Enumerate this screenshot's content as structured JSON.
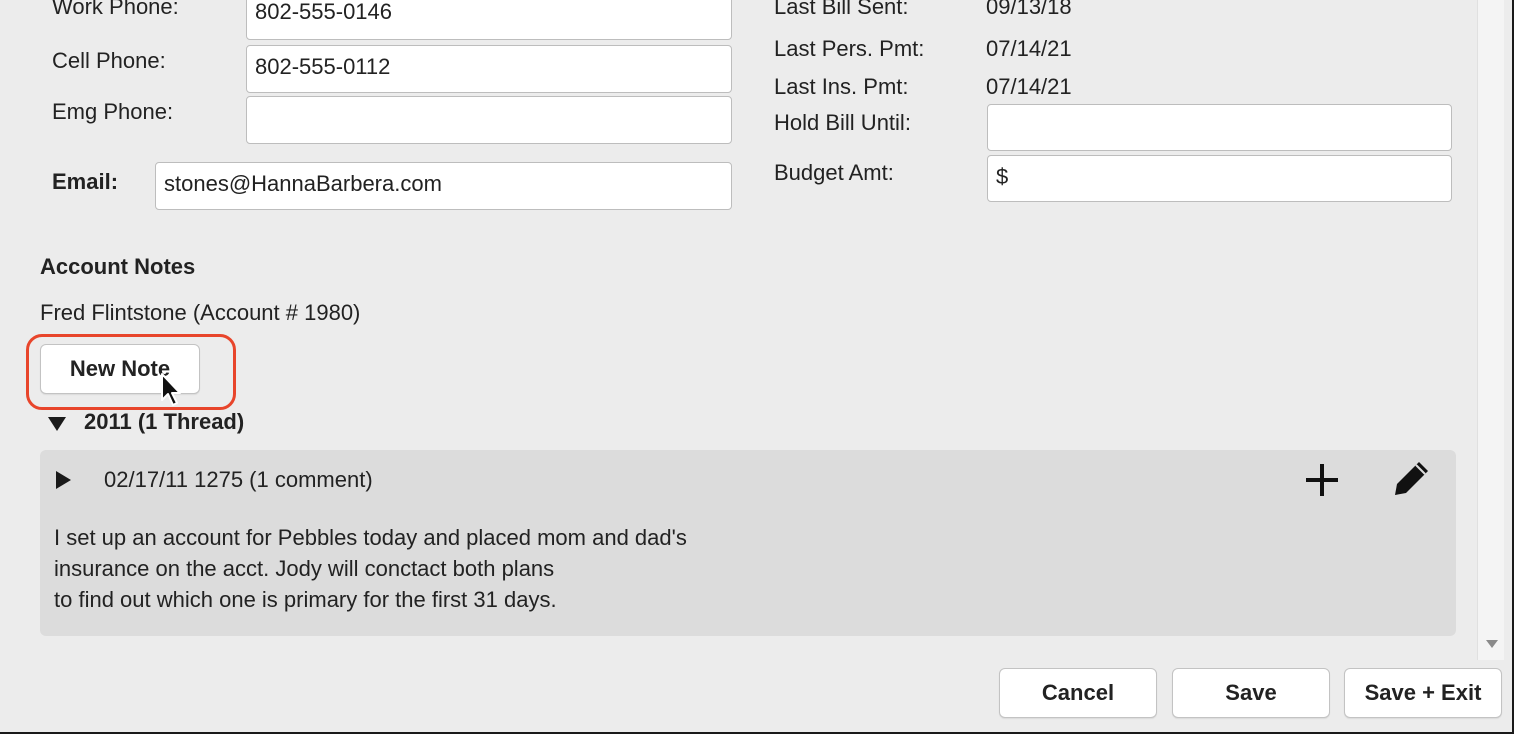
{
  "contact": {
    "work_phone_label": "Work Phone:",
    "work_phone_value": "802-555-0146",
    "cell_phone_label": "Cell Phone:",
    "cell_phone_value": "802-555-0112",
    "emg_phone_label": "Emg Phone:",
    "emg_phone_value": "",
    "email_label": "Email:",
    "email_value": "stones@HannaBarbera.com"
  },
  "billing": {
    "last_bill_sent_label": "Last Bill Sent:",
    "last_bill_sent_value": "09/13/18",
    "last_pers_pmt_label": "Last Pers. Pmt:",
    "last_pers_pmt_value": "07/14/21",
    "last_ins_pmt_label": "Last Ins. Pmt:",
    "last_ins_pmt_value": "07/14/21",
    "hold_bill_label": "Hold Bill Until:",
    "hold_bill_value": "",
    "budget_label": "Budget Amt:",
    "budget_value": "$"
  },
  "notes": {
    "heading": "Account Notes",
    "account_line": "Fred Flintstone (Account # 1980)",
    "new_note_label": "New Note",
    "group_label": "2011 (1 Thread)",
    "thread_header": "02/17/11 1275  (1 comment)",
    "body_lines": [
      "I set up an account for Pebbles today and placed mom and dad's",
      "insurance on the acct. Jody will conctact both plans",
      "to find out which one is primary for the first 31 days."
    ]
  },
  "footer": {
    "cancel_label": "Cancel",
    "save_label": "Save",
    "save_exit_label": "Save + Exit"
  },
  "colors": {
    "highlight": "#e8452b",
    "note_background": "#dcdcdc"
  },
  "icons": [
    "add-comment-icon",
    "edit-note-icon",
    "expand-triangle-icon",
    "collapse-triangle-icon",
    "mouse-cursor-icon"
  ]
}
